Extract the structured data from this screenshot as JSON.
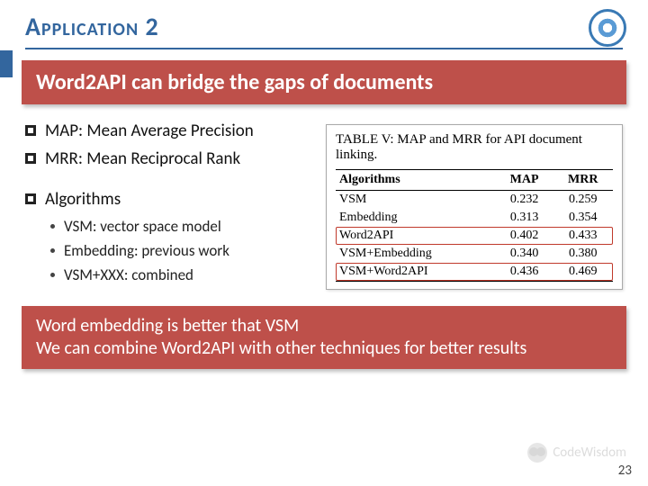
{
  "header": {
    "title": "Application 2"
  },
  "banner": "Word2API can bridge the gaps of documents",
  "bullets": {
    "map": "MAP: Mean Average Precision",
    "mrr": "MRR: Mean Reciprocal Rank",
    "algos_label": "Algorithms",
    "algos": {
      "vsm": "VSM: vector space model",
      "emb": "Embedding: previous work",
      "combined": "VSM+XXX: combined"
    }
  },
  "chart_data": {
    "type": "table",
    "caption": "TABLE V: MAP and MRR for API document linking.",
    "columns": [
      "Algorithms",
      "MAP",
      "MRR"
    ],
    "rows": [
      {
        "algo": "VSM",
        "map": "0.232",
        "mrr": "0.259",
        "highlight": false
      },
      {
        "algo": "Embedding",
        "map": "0.313",
        "mrr": "0.354",
        "highlight": false
      },
      {
        "algo": "Word2API",
        "map": "0.402",
        "mrr": "0.433",
        "highlight": true
      },
      {
        "algo": "VSM+Embedding",
        "map": "0.340",
        "mrr": "0.380",
        "highlight": false
      },
      {
        "algo": "VSM+Word2API",
        "map": "0.436",
        "mrr": "0.469",
        "highlight": true
      }
    ]
  },
  "footer_banner": {
    "line1": "Word embedding is better that VSM",
    "line2": "We can combine Word2API with other techniques for better results"
  },
  "watermark": "CodeWisdom",
  "page_number": "23"
}
